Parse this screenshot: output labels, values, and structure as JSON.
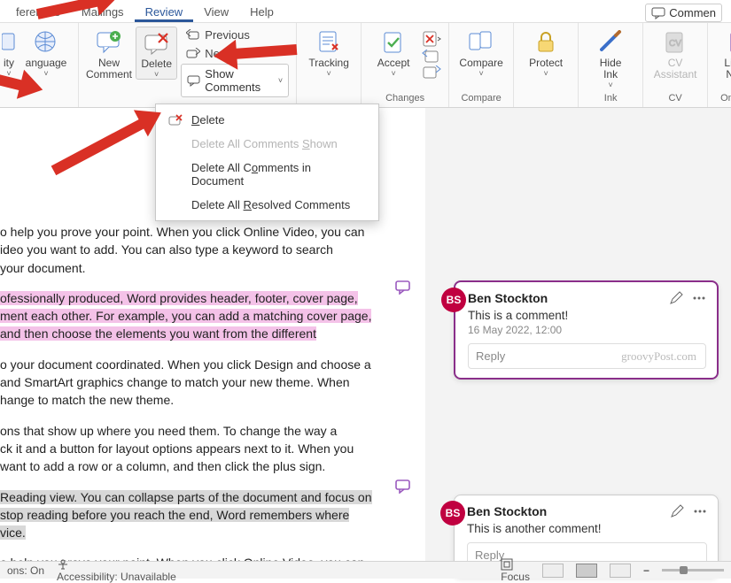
{
  "tabs": {
    "items": [
      "ferences",
      "Mailings",
      "Review",
      "View",
      "Help"
    ],
    "active_index": 2,
    "comments_btn": "Commen"
  },
  "ribbon": {
    "language": {
      "label": "anguage",
      "mini_chev": "˅"
    },
    "new_comment": {
      "label1": "New",
      "label2": "Comment"
    },
    "delete_btn": {
      "label": "Delete"
    },
    "previous": "Previous",
    "next": "Next",
    "show_comments": "Show Comments",
    "tracking": {
      "label": "Tracking"
    },
    "accept": {
      "label": "Accept"
    },
    "compare": {
      "label": "Compare"
    },
    "protect": {
      "label": "Protect"
    },
    "hide_ink": {
      "label1": "Hide",
      "label2": "Ink"
    },
    "cv_assistant": {
      "label1": "CV",
      "label2": "Assistant"
    },
    "linked_notes": {
      "label1": "Linked",
      "label2": "Notes"
    },
    "group_changes": "Changes",
    "group_compare": "Compare",
    "group_ink": "Ink",
    "group_cv": "CV",
    "group_onenote": "OneNote"
  },
  "delete_menu": {
    "items": [
      {
        "label": "Delete",
        "disabled": false,
        "icon": true
      },
      {
        "label": "Delete All Comments Shown",
        "disabled": true,
        "icon": false
      },
      {
        "label": "Delete All Comments in Document",
        "disabled": false,
        "icon": false
      },
      {
        "label": "Delete All Resolved Comments",
        "disabled": false,
        "icon": false
      }
    ]
  },
  "doc": {
    "p1a": "o help you prove your point. When you click Online Video, you can",
    "p1b": "ideo you want to add. You can also type a keyword to search",
    "p1c": " your document.",
    "p2a": "ofessionally produced, Word provides header, footer, cover page,",
    "p2b": "ment each other. For example, you can add a matching cover page,",
    "p2c": "and then choose the elements you want from the different",
    "p3a": "o your document coordinated. When you click Design and choose a",
    "p3b": " and SmartArt graphics change to match your new theme. When",
    "p3c": "hange to match the new theme.",
    "p4a": "ons that show up where you need them. To change the way a",
    "p4b": "ck it and a button for layout options appears next to it. When you",
    "p4c": "want to add a row or a column, and then click the plus sign.",
    "p5a": " Reading view. You can collapse parts of the document and focus on",
    "p5b": " stop reading before you reach the end, Word remembers where",
    "p5c": "vice.",
    "p6a": "o help you prove your point. When you click Online Video, you can"
  },
  "comments": [
    {
      "initials": "BS",
      "author": "Ben Stockton",
      "body": "This is a comment!",
      "timestamp": "16 May 2022, 12:00",
      "reply_placeholder": "Reply",
      "watermark": "groovyPost.com",
      "active": true
    },
    {
      "initials": "BS",
      "author": "Ben Stockton",
      "body": "This is another comment!",
      "timestamp": "",
      "reply_placeholder": "Reply",
      "watermark": "",
      "active": false
    }
  ],
  "status": {
    "left1": "ons: On",
    "accessibility": "Accessibility: Unavailable",
    "focus": "Focus"
  }
}
